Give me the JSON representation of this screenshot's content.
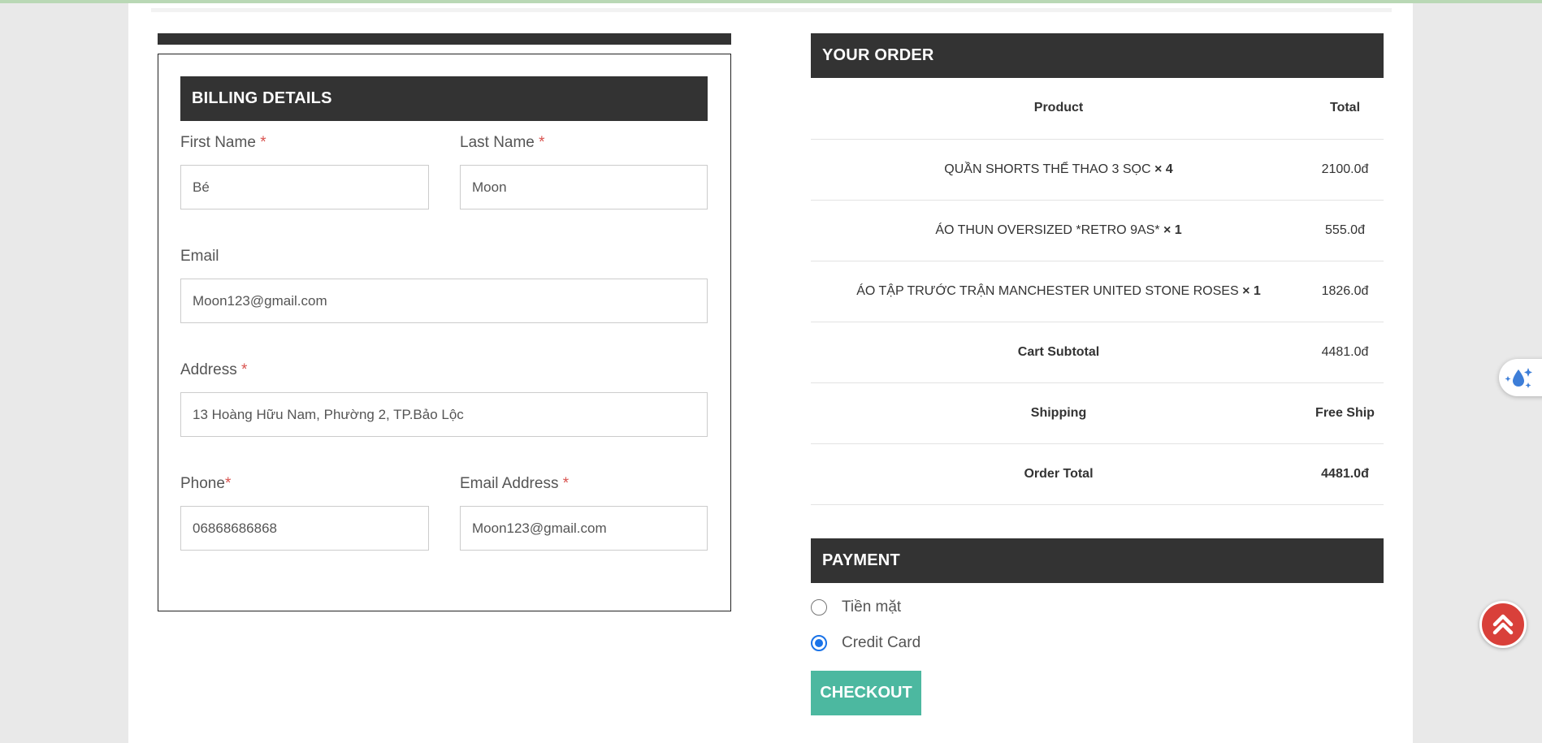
{
  "billing": {
    "title": "BILLING DETAILS",
    "first_name": {
      "label": "First Name",
      "required": "*",
      "value": "Bé"
    },
    "last_name": {
      "label": "Last Name",
      "required": "*",
      "value": "Moon"
    },
    "email": {
      "label": "Email",
      "value": "Moon123@gmail.com"
    },
    "address": {
      "label": "Address",
      "required": "*",
      "value": "13 Hoàng Hữu Nam, Phường 2, TP.Bảo Lộc"
    },
    "phone": {
      "label": "Phone",
      "required": "*",
      "value": "06868686868"
    },
    "email_address": {
      "label": "Email Address",
      "required": "*",
      "value": "Moon123@gmail.com"
    }
  },
  "order": {
    "title": "YOUR ORDER",
    "headers": {
      "product": "Product",
      "total": "Total"
    },
    "items": [
      {
        "name": "QUẦN SHORTS THỂ THAO 3 SỌC",
        "qty": "× 4",
        "total": "2100.0đ"
      },
      {
        "name": "ÁO THUN OVERSIZED *RETRO 9AS*",
        "qty": "× 1",
        "total": "555.0đ"
      },
      {
        "name": "ÁO TẬP TRƯỚC TRẬN MANCHESTER UNITED STONE ROSES",
        "qty": "× 1",
        "total": "1826.0đ"
      }
    ],
    "subtotal": {
      "label": "Cart Subtotal",
      "value": "4481.0đ"
    },
    "shipping": {
      "label": "Shipping",
      "value": "Free Ship"
    },
    "order_total": {
      "label": "Order Total",
      "value": "4481.0đ"
    }
  },
  "payment": {
    "title": "PAYMENT",
    "options": [
      {
        "label": "Tiền mặt",
        "selected": false
      },
      {
        "label": "Credit Card",
        "selected": true
      }
    ],
    "checkout_label": "CHECKOUT"
  },
  "colors": {
    "header_bg": "#333333",
    "required": "#d9534f",
    "checkout": "#4cb8a0",
    "scroll_top": "#d9403a",
    "radio_selected": "#1a73e8"
  },
  "icons": {
    "scroll_top": "double-chevron-up-icon",
    "floating_widget": "water-drop-sparkle-icon"
  }
}
